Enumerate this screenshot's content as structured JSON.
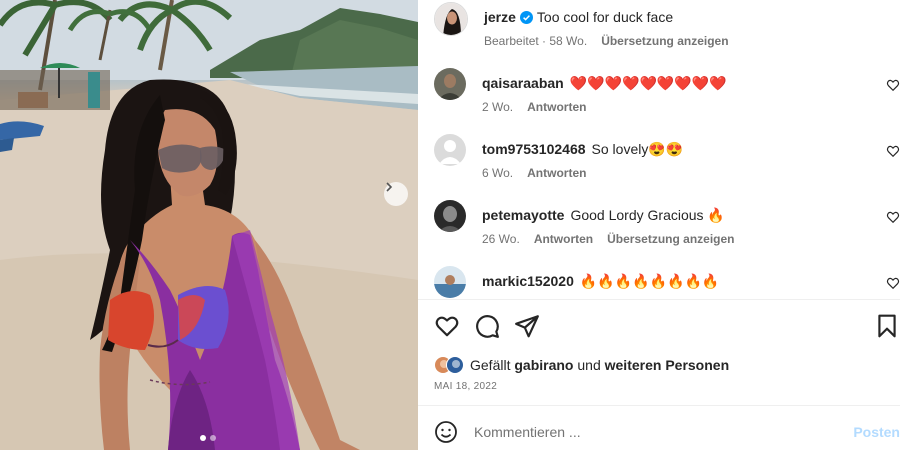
{
  "post": {
    "author": "jerze",
    "caption": "Too cool for duck face",
    "meta_edited": "Bearbeitet",
    "meta_age": "58 Wo.",
    "translate_label": "Übersetzung anzeigen"
  },
  "comments": [
    {
      "username": "qaisaraaban",
      "text": "❤️❤️❤️❤️❤️❤️❤️❤️❤️",
      "age": "2 Wo.",
      "reply": "Antworten",
      "translate": ""
    },
    {
      "username": "tom9753102468",
      "text": "So lovely😍😍",
      "age": "6 Wo.",
      "reply": "Antworten",
      "translate": ""
    },
    {
      "username": "petemayotte",
      "text": "Good Lordy Gracious 🔥",
      "age": "26 Wo.",
      "reply": "Antworten",
      "translate": "Übersetzung anzeigen"
    },
    {
      "username": "markic152020",
      "text": "🔥🔥🔥🔥🔥🔥🔥🔥",
      "age": "",
      "reply": "",
      "translate": ""
    }
  ],
  "likes": {
    "prefix": "Gefällt",
    "user": "gabirano",
    "joiner": "und",
    "others": "weiteren Personen"
  },
  "date": "MAI 18, 2022",
  "comment_box": {
    "placeholder": "Kommentieren ...",
    "post_label": "Posten"
  },
  "carousel": {
    "slide_count": 2,
    "active_index": 0
  },
  "icons": {
    "like": "heart-icon",
    "comment": "comment-bubble-icon",
    "share": "paper-plane-icon",
    "save": "bookmark-icon",
    "emoji": "smiley-icon",
    "next": "chevron-right-icon",
    "verified": "verified-badge-icon"
  },
  "colors": {
    "verified": "#0095f6",
    "post_button": "#b3dbff",
    "secondary_text": "#737373"
  }
}
